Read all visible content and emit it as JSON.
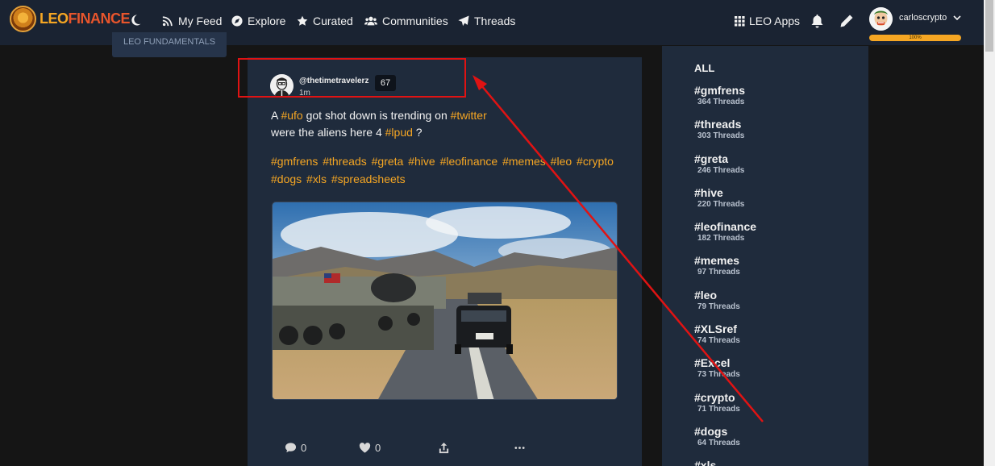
{
  "brand": {
    "leo": "LEO",
    "finance": "FINANCE"
  },
  "nav": {
    "my_feed": "My Feed",
    "explore": "Explore",
    "curated": "Curated",
    "communities": "Communities",
    "threads": "Threads",
    "leo_apps": "LEO Apps"
  },
  "user": {
    "name": "carloscrypto",
    "progress_label": "100%",
    "progress": 1.0
  },
  "left_stub": {
    "label": "LEO FUNDAMENTALS"
  },
  "post": {
    "author": "@thetimetravelerz",
    "reputation": "67",
    "time": "1m",
    "line1": {
      "a": "A ",
      "tag1": "#ufo",
      "b": " got shot down is trending on ",
      "tag2": "#twitter"
    },
    "line2": {
      "a": "were the aliens here 4 ",
      "tag": "#lpud",
      "b": " ?"
    },
    "tags": [
      "#gmfrens",
      "#threads",
      "#greta",
      "#hive",
      "#leofinance",
      "#memes",
      "#leo",
      "#crypto",
      "#dogs",
      "#xls",
      "#spreadsheets"
    ],
    "comments": "0",
    "likes": "0"
  },
  "sidebar": {
    "all_label": "ALL",
    "items": [
      {
        "tag": "#gmfrens",
        "count": "364 Threads"
      },
      {
        "tag": "#threads",
        "count": "303 Threads"
      },
      {
        "tag": "#greta",
        "count": "246 Threads"
      },
      {
        "tag": "#hive",
        "count": "220 Threads"
      },
      {
        "tag": "#leofinance",
        "count": "182 Threads"
      },
      {
        "tag": "#memes",
        "count": "97 Threads"
      },
      {
        "tag": "#leo",
        "count": "79 Threads"
      },
      {
        "tag": "#XLSref",
        "count": "74 Threads"
      },
      {
        "tag": "#Excel",
        "count": "73 Threads"
      },
      {
        "tag": "#crypto",
        "count": "71 Threads"
      },
      {
        "tag": "#dogs",
        "count": "64 Threads"
      },
      {
        "tag": "#xls",
        "count": ""
      }
    ]
  },
  "colors": {
    "accent": "#f5a623",
    "annotation": "#e01313",
    "card": "#1f2b3c",
    "topbar": "#1a2332"
  }
}
